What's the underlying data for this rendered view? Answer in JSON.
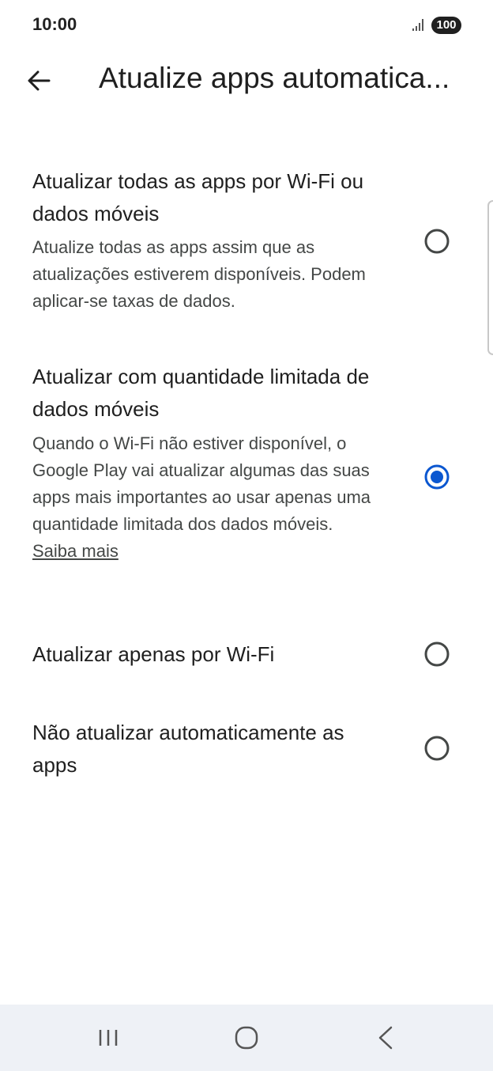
{
  "status": {
    "time": "10:00",
    "battery": "100"
  },
  "header": {
    "back_icon": "arrow-left-icon",
    "title": "Atualize apps automatica..."
  },
  "options": [
    {
      "title": "Atualizar todas as apps por Wi-Fi ou dados móveis",
      "description": "Atualize todas as apps assim que as atualizações estiverem disponíveis. Podem aplicar-se taxas de dados.",
      "selected": false
    },
    {
      "title": "Atualizar com quantidade limitada de dados móveis",
      "description": "Quando o Wi-Fi não estiver disponível, o Google Play vai atualizar algumas das suas apps mais importantes ao usar apenas uma quantidade limitada dos dados móveis.",
      "link": "Saiba mais",
      "selected": true
    },
    {
      "title": "Atualizar apenas por Wi-Fi",
      "selected": false
    },
    {
      "title": "Não atualizar automaticamente as apps",
      "selected": false
    }
  ],
  "nav": {
    "recents_icon": "recents-icon",
    "home_icon": "home-icon",
    "back_icon": "back-chevron-icon"
  },
  "colors": {
    "accent": "#0b57d0",
    "radio_off": "#444746",
    "nav_bg": "#eef1f6"
  }
}
